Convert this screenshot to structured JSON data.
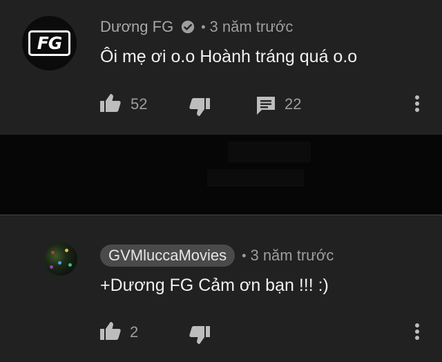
{
  "comments": [
    {
      "author": "Dương FG",
      "verified": true,
      "time": "3 năm trước",
      "text": "Ôi mẹ ơi o.o Hoành tráng quá o.o",
      "likes": "52",
      "replies": "22",
      "avatar_text": "FG"
    },
    {
      "author": "GVMluccaMovies",
      "time": "3 năm trước",
      "text": "+Dương FG Cảm ơn bạn !!! :)",
      "likes": "2"
    }
  ],
  "separator": "•",
  "icons": {
    "like": "thumb-up-icon",
    "dislike": "thumb-down-icon",
    "reply": "comment-icon",
    "more": "more-vert-icon",
    "verified": "verified-check-icon"
  },
  "colors": {
    "background": "#212121",
    "redacted_band": "#060606",
    "text": "#f1f1f1",
    "secondary_text": "#9e9e9e",
    "author_chip": "#4a4a4a"
  }
}
